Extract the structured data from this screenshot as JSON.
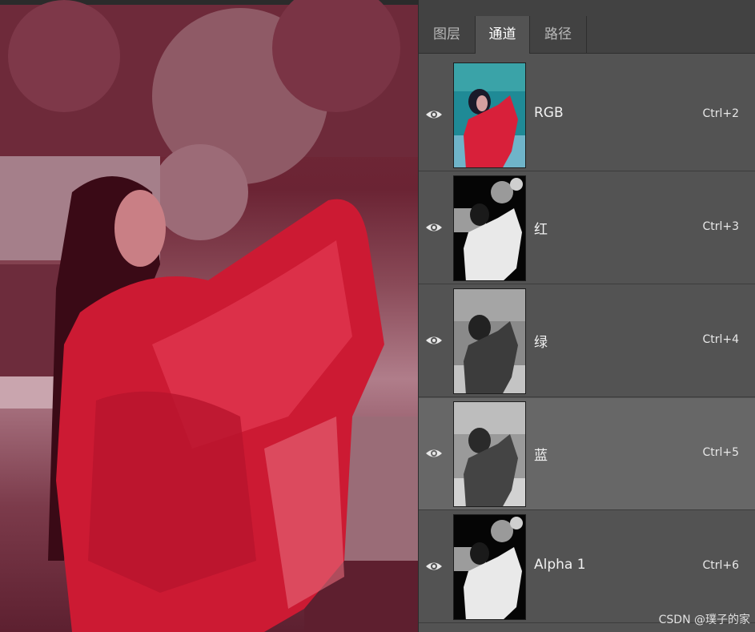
{
  "panel": {
    "tabs": [
      {
        "label": "图层",
        "active": false
      },
      {
        "label": "通道",
        "active": true
      },
      {
        "label": "路径",
        "active": false
      }
    ],
    "channels": [
      {
        "name": "RGB",
        "shortcut": "Ctrl+2",
        "visible": true,
        "selected": false,
        "thumb": "color"
      },
      {
        "name": "红",
        "shortcut": "Ctrl+3",
        "visible": true,
        "selected": false,
        "thumb": "high-contrast"
      },
      {
        "name": "绿",
        "shortcut": "Ctrl+4",
        "visible": true,
        "selected": false,
        "thumb": "gray"
      },
      {
        "name": "蓝",
        "shortcut": "Ctrl+5",
        "visible": true,
        "selected": true,
        "thumb": "gray-light"
      },
      {
        "name": "Alpha 1",
        "shortcut": "Ctrl+6",
        "visible": true,
        "selected": false,
        "thumb": "high-contrast"
      }
    ]
  },
  "watermark": "CSDN @璞子的家",
  "icons": {
    "visibility": "eye-icon"
  },
  "colors": {
    "panel_bg": "#535353",
    "selected_row": "#676767",
    "tab_bar": "#424242",
    "canvas_tint": "#c81e37"
  }
}
